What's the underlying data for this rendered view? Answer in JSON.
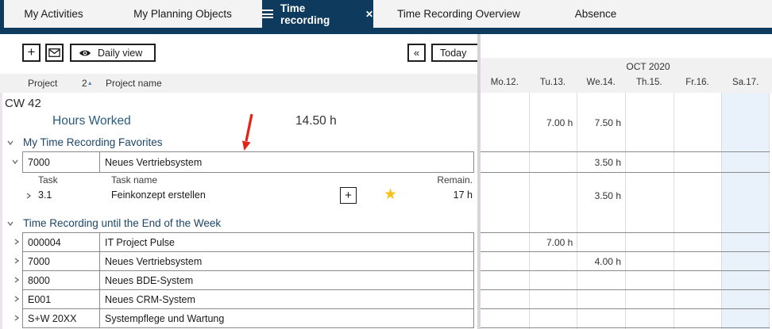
{
  "tabs": [
    {
      "label": "My Activities",
      "active": false
    },
    {
      "label": "My Planning Objects",
      "active": false
    },
    {
      "label": "Time recording",
      "active": true
    },
    {
      "label": "Time Recording Overview",
      "active": false
    },
    {
      "label": "Absence",
      "active": false
    }
  ],
  "toolbar": {
    "add": "+",
    "daily_view": "Daily view",
    "prev": "«",
    "today": "Today"
  },
  "columns": {
    "project": "Project",
    "sort_order": "2",
    "project_name": "Project name"
  },
  "grid": {
    "month": "OCT 2020",
    "days": [
      "Mo.12.",
      "Tu.13.",
      "We.14.",
      "Th.15.",
      "Fr.16.",
      "Sa.17."
    ],
    "hours_tu": "7.00 h",
    "hours_we": "7.50 h",
    "fav_we": "3.50 h",
    "task_we": "3.50 h",
    "w0_tu": "7.00 h",
    "w1_we": "4.00 h"
  },
  "week": {
    "cw": "CW 42",
    "hours_label": "Hours Worked",
    "hours_total": "14.50 h"
  },
  "favorites": {
    "title": "My Time Recording Favorites",
    "project_id": "7000",
    "project_name": "Neues Vertriebsystem",
    "task_col": "Task",
    "task_name_col": "Task name",
    "remain_col": "Remain.",
    "task_id": "3.1",
    "task_name": "Feinkonzept erstellen",
    "task_remain": "17 h"
  },
  "until_eow": {
    "title": "Time Recording until the End of the Week",
    "rows": [
      {
        "id": "000004",
        "name": "IT Project Pulse"
      },
      {
        "id": "7000",
        "name": "Neues Vertriebsystem"
      },
      {
        "id": "8000",
        "name": "Neues BDE-System"
      },
      {
        "id": "E001",
        "name": "Neues CRM-System"
      },
      {
        "id": "S+W 20XX",
        "name": "Systempflege und Wartung"
      }
    ]
  },
  "colors": {
    "accent_navy": "#0d3a5d",
    "weekend_blue": "#e9f2fb",
    "star_gold": "#f5c21b",
    "arrow_red": "#e42217"
  }
}
